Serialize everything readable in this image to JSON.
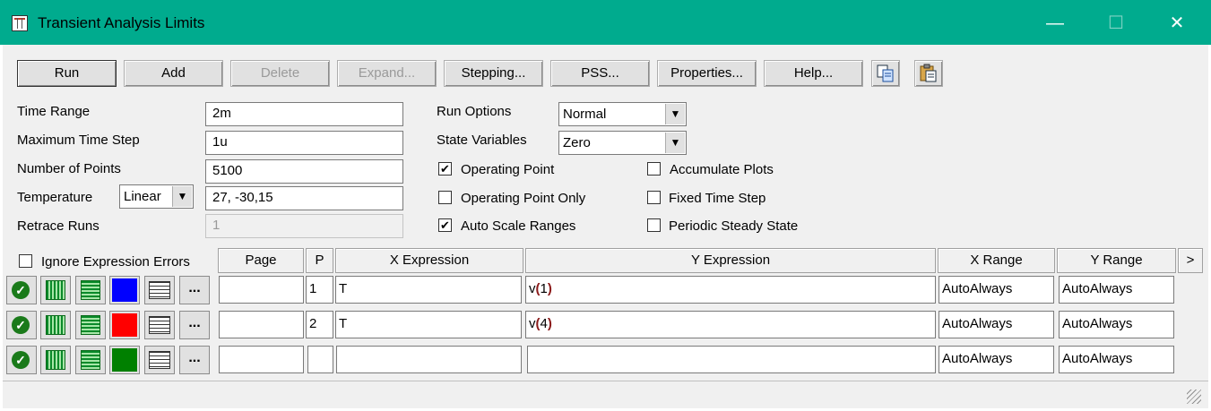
{
  "window": {
    "title": "Transient Analysis Limits",
    "minimize": "—",
    "maximize": "☐",
    "close": "✕"
  },
  "toolbar": {
    "run": "Run",
    "add": "Add",
    "delete": "Delete",
    "expand": "Expand...",
    "stepping": "Stepping...",
    "pss": "PSS...",
    "properties": "Properties...",
    "help": "Help...",
    "copy_icon": "copy-icon",
    "paste_icon": "paste-icon"
  },
  "fields": {
    "time_range_label": "Time Range",
    "time_range": "2m",
    "max_time_step_label": "Maximum Time Step",
    "max_time_step": "1u",
    "num_points_label": "Number of Points",
    "num_points": "5100",
    "temperature_label": "Temperature",
    "temperature_mode": "Linear",
    "temperature": "27, -30,15",
    "retrace_label": "Retrace Runs",
    "retrace": "1"
  },
  "options": {
    "run_options_label": "Run Options",
    "run_options": "Normal",
    "state_variables_label": "State Variables",
    "state_variables": "Zero",
    "operating_point": "Operating Point",
    "operating_point_checked": true,
    "operating_point_only": "Operating Point Only",
    "operating_point_only_checked": false,
    "auto_scale": "Auto Scale Ranges",
    "auto_scale_checked": true,
    "accumulate_plots": "Accumulate Plots",
    "accumulate_plots_checked": false,
    "fixed_time_step": "Fixed Time Step",
    "fixed_time_step_checked": false,
    "periodic_steady_state": "Periodic Steady State",
    "periodic_steady_state_checked": false
  },
  "table": {
    "ignore_errors": "Ignore Expression Errors",
    "ignore_errors_checked": false,
    "headers": {
      "page": "Page",
      "p": "P",
      "x_expression": "X Expression",
      "y_expression": "Y Expression",
      "x_range": "X Range",
      "y_range": "Y Range",
      "more": ">"
    },
    "rows": [
      {
        "color": "#0000ff",
        "page": "",
        "p": "1",
        "x": "T",
        "y_fn": "v",
        "y_open": "(",
        "y_arg": "1",
        "y_close": ")",
        "x_range": "AutoAlways",
        "y_range": "AutoAlways"
      },
      {
        "color": "#ff0000",
        "page": "",
        "p": "2",
        "x": "T",
        "y_fn": "v",
        "y_open": "(",
        "y_arg": "4",
        "y_close": ")",
        "x_range": "AutoAlways",
        "y_range": "AutoAlways"
      },
      {
        "color": "#008000",
        "page": "",
        "p": "",
        "x": "",
        "y_fn": "",
        "y_open": "",
        "y_arg": "",
        "y_close": "",
        "x_range": "AutoAlways",
        "y_range": "AutoAlways"
      }
    ],
    "dots": "..."
  }
}
